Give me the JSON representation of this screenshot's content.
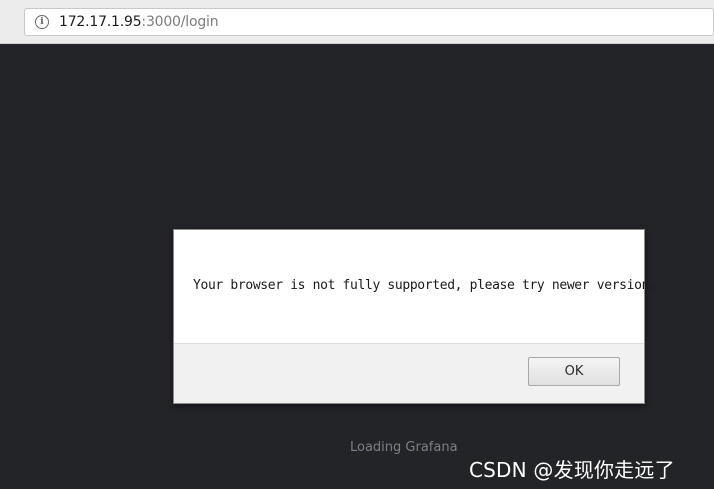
{
  "browser": {
    "url_host": "172.17.1.95",
    "url_path": ":3000/login",
    "info_icon": "info-icon"
  },
  "page": {
    "loading_text": "Loading Grafana"
  },
  "dialog": {
    "message": "Your browser is not fully supported, please try newer version.",
    "ok_label": "OK"
  },
  "watermark": {
    "text": "CSDN @发现你走远了"
  },
  "colors": {
    "page_background": "#232428",
    "dialog_background": "#ffffff",
    "dialog_footer": "#f1f1f1",
    "loading_text": "#7b7f87"
  }
}
